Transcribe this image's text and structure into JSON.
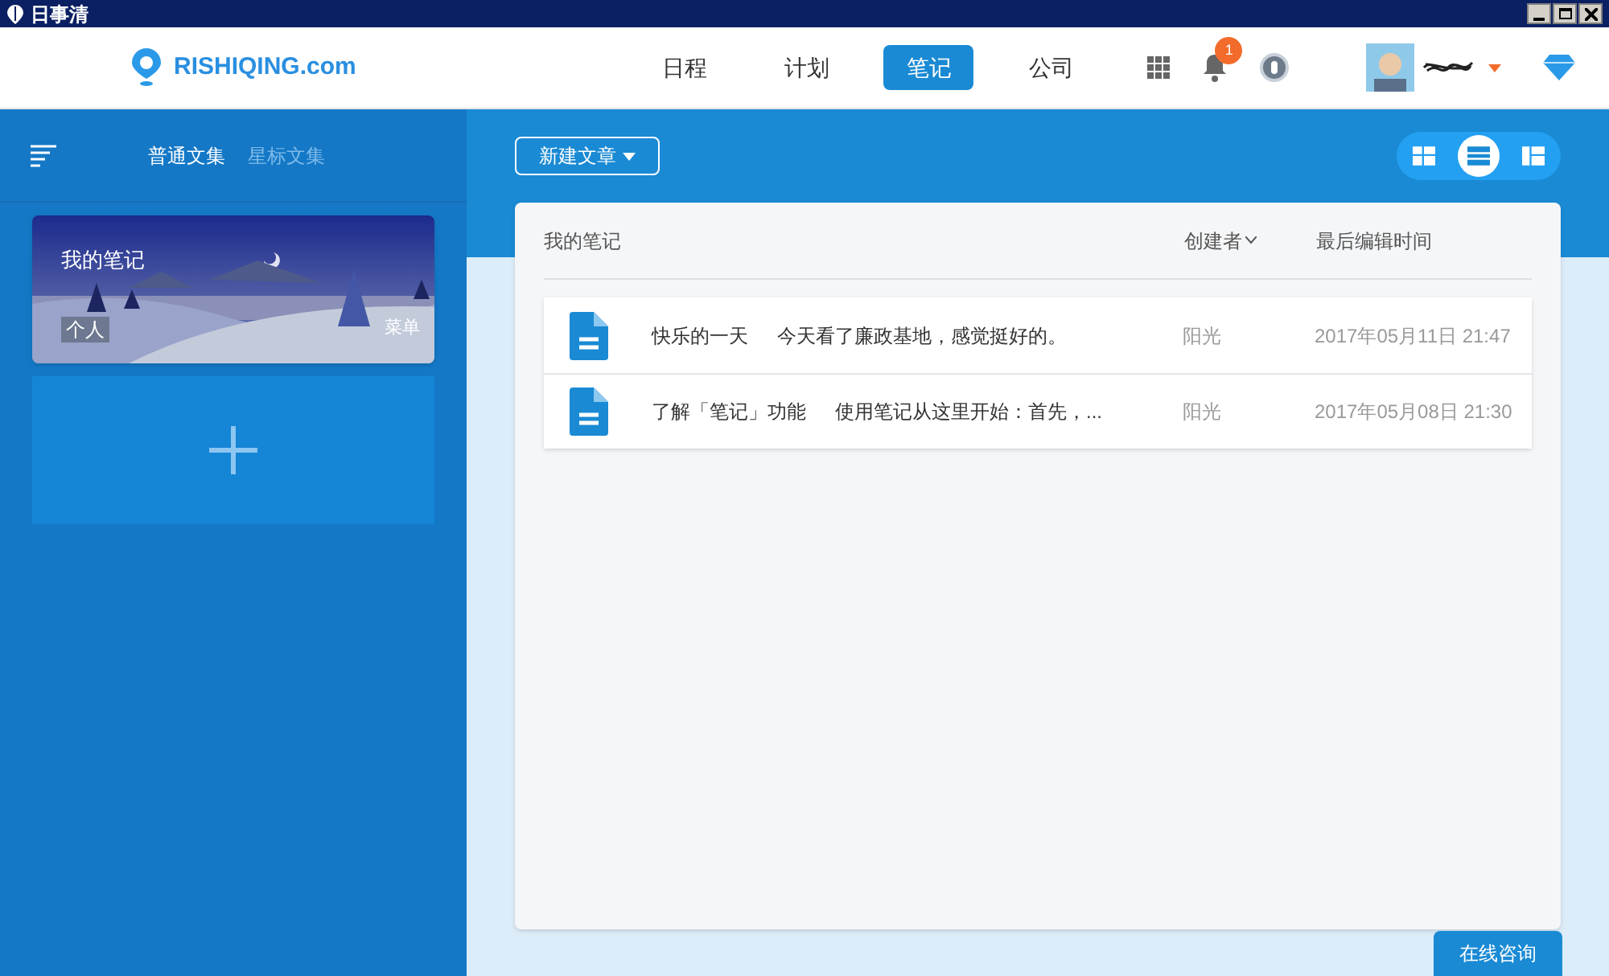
{
  "window": {
    "title": "日事清"
  },
  "header": {
    "logo": "RISHIQING.com",
    "nav": [
      {
        "label": "日程",
        "selected": false
      },
      {
        "label": "计划",
        "selected": false
      },
      {
        "label": "笔记",
        "selected": true
      },
      {
        "label": "公司",
        "selected": false
      }
    ],
    "notification_count": "1"
  },
  "sidebar": {
    "tabs": [
      {
        "label": "普通文集",
        "selected": true
      },
      {
        "label": "星标文集",
        "selected": false
      }
    ],
    "notebooks": [
      {
        "kind": "picture",
        "title": "我的笔记",
        "tag": "个人",
        "menu": "菜单"
      }
    ]
  },
  "toolbar": {
    "new_button": "新建文章",
    "views": [
      {
        "kind": "grid",
        "selected": false
      },
      {
        "kind": "list",
        "selected": true
      },
      {
        "kind": "split",
        "selected": false
      }
    ]
  },
  "table": {
    "columns": [
      "我的笔记",
      "创建者",
      "最后编辑时间"
    ],
    "rows": [
      {
        "title": "快乐的一天",
        "summary": "今天看了廉政基地，感觉挺好的。",
        "creator": "阳光",
        "time": "2017年05月11日 21:47"
      },
      {
        "title": "了解「笔记」功能",
        "summary": "使用笔记从这里开始：首先，...",
        "creator": "阳光",
        "time": "2017年05月08日 21:30"
      }
    ]
  },
  "consult_button": "在线咨询"
}
